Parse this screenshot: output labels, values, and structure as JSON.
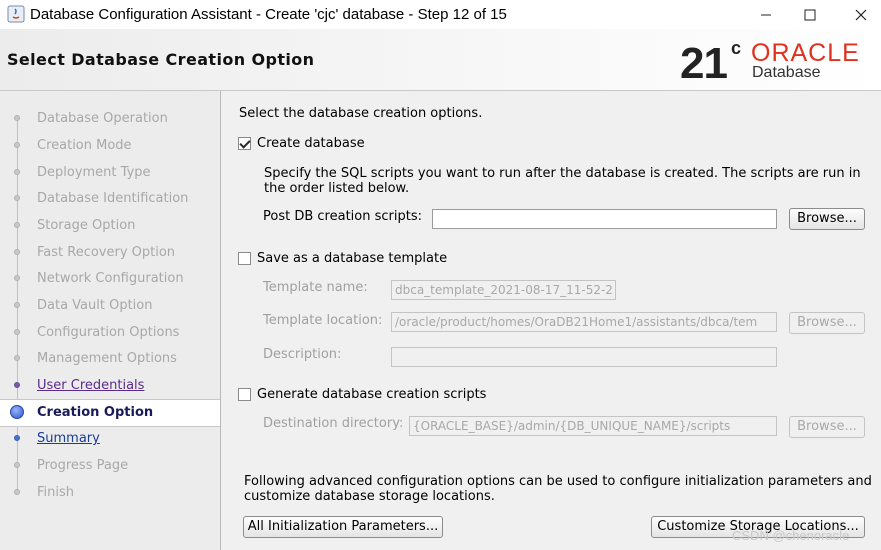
{
  "window": {
    "title": "Database Configuration Assistant - Create 'cjc' database - Step 12 of 15",
    "controls": [
      "minimize",
      "maximize",
      "close"
    ]
  },
  "header": {
    "title": "Select Database Creation Option",
    "logo": {
      "version": "21",
      "superscript": "c",
      "brand": "ORACLE",
      "product": "Database"
    }
  },
  "sidebar": {
    "steps": [
      {
        "label": "Database Operation",
        "state": "disabled"
      },
      {
        "label": "Creation Mode",
        "state": "disabled"
      },
      {
        "label": "Deployment Type",
        "state": "disabled"
      },
      {
        "label": "Database Identification",
        "state": "disabled"
      },
      {
        "label": "Storage Option",
        "state": "disabled"
      },
      {
        "label": "Fast Recovery Option",
        "state": "disabled"
      },
      {
        "label": "Network Configuration",
        "state": "disabled"
      },
      {
        "label": "Data Vault Option",
        "state": "disabled"
      },
      {
        "label": "Configuration Options",
        "state": "disabled"
      },
      {
        "label": "Management Options",
        "state": "disabled"
      },
      {
        "label": "User Credentials",
        "state": "visited"
      },
      {
        "label": "Creation Option",
        "state": "current"
      },
      {
        "label": "Summary",
        "state": "link"
      },
      {
        "label": "Progress Page",
        "state": "disabled"
      },
      {
        "label": "Finish",
        "state": "disabled"
      }
    ]
  },
  "main": {
    "intro": "Select the database creation options.",
    "create_db": {
      "label": "Create database",
      "checked": true,
      "desc_line1": "Specify the SQL scripts you want to run after the database is created. The scripts are run in",
      "desc_line2": "the order listed below.",
      "post_scripts_label": "Post DB creation scripts:",
      "post_scripts_value": "",
      "browse": "Browse..."
    },
    "save_template": {
      "label": "Save as a database template",
      "checked": false,
      "name_label": "Template name:",
      "name_value": "dbca_template_2021-08-17_11-52-2",
      "location_label": "Template location:",
      "location_value": "/oracle/product/homes/OraDB21Home1/assistants/dbca/tem",
      "browse": "Browse...",
      "description_label": "Description:",
      "description_value": ""
    },
    "gen_scripts": {
      "label": "Generate database creation scripts",
      "checked": false,
      "dest_label": "Destination directory:",
      "dest_value": "{ORACLE_BASE}/admin/{DB_UNIQUE_NAME}/scripts",
      "browse": "Browse..."
    },
    "advanced_line1": "Following advanced configuration options can be used to configure initialization parameters and",
    "advanced_line2": "customize database storage locations.",
    "init_params_button": "All Initialization Parameters...",
    "storage_button": "Customize Storage Locations..."
  },
  "watermark": "CSDN @chenoracle"
}
